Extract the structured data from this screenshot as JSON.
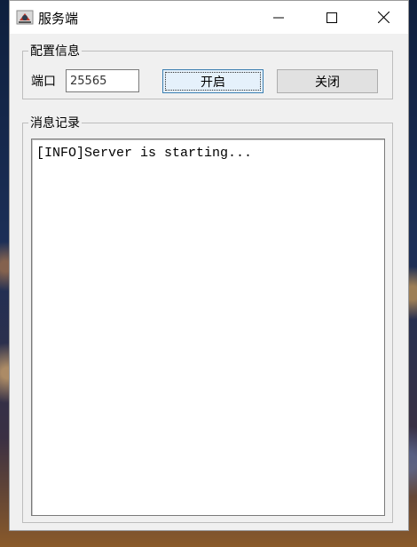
{
  "window": {
    "title": "服务端",
    "controls": {
      "minimize": "minimize-icon",
      "maximize": "maximize-icon",
      "close": "close-icon"
    }
  },
  "config_group": {
    "legend": "配置信息",
    "port_label": "端口",
    "port_value": "25565",
    "start_button": "开启",
    "close_button": "关闭"
  },
  "log_group": {
    "legend": "消息记录",
    "log_text": "[INFO]Server is starting..."
  },
  "colors": {
    "window_bg": "#f0f0f0",
    "titlebar_bg": "#ffffff",
    "focused_button_bg": "#e5f1fb",
    "focused_button_border": "#3c7fb1",
    "button_bg": "#e1e1e1"
  }
}
